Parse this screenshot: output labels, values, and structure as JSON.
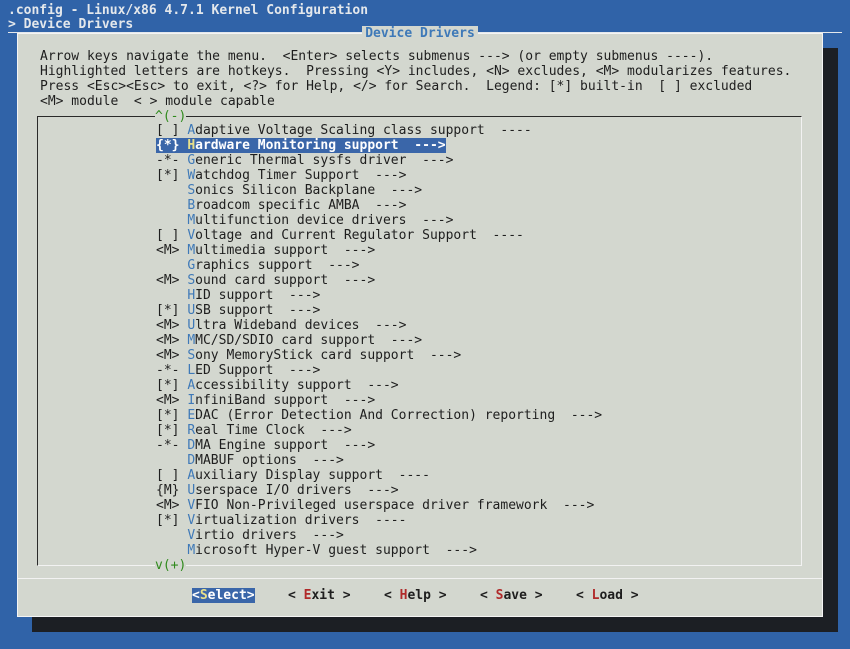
{
  "header": {
    "line1": ".config - Linux/x86 4.7.1 Kernel Configuration",
    "line2": "> Device Drivers"
  },
  "dialog": {
    "title": "Device Drivers",
    "help_lines": [
      "Arrow keys navigate the menu.  <Enter> selects submenus ---> (or empty submenus ----).",
      "Highlighted letters are hotkeys.  Pressing <Y> includes, <N> excludes, <M> modularizes features.",
      "Press <Esc><Esc> to exit, <?> for Help, </> for Search.  Legend: [*] built-in  [ ] excluded",
      "<M> module  < > module capable"
    ],
    "scroll_up": "^(-)",
    "scroll_down": "v(+)"
  },
  "menu": {
    "selected_index": 1,
    "items": [
      {
        "state": "[ ]",
        "hotkey": "A",
        "rest": "daptive Voltage Scaling class support  ----"
      },
      {
        "state": "{*}",
        "hotkey": "H",
        "rest": "ardware Monitoring support  --->"
      },
      {
        "state": "-*-",
        "hotkey": "G",
        "rest": "eneric Thermal sysfs driver  --->"
      },
      {
        "state": "[*]",
        "hotkey": "W",
        "rest": "atchdog Timer Support  --->"
      },
      {
        "state": "   ",
        "hotkey": "S",
        "rest": "onics Silicon Backplane  --->"
      },
      {
        "state": "   ",
        "hotkey": "B",
        "rest": "roadcom specific AMBA  --->"
      },
      {
        "state": "   ",
        "hotkey": "M",
        "rest": "ultifunction device drivers  --->"
      },
      {
        "state": "[ ]",
        "hotkey": "V",
        "rest": "oltage and Current Regulator Support  ----"
      },
      {
        "state": "<M>",
        "hotkey": "M",
        "rest": "ultimedia support  --->"
      },
      {
        "state": "   ",
        "hotkey": "G",
        "rest": "raphics support  --->"
      },
      {
        "state": "<M>",
        "hotkey": "S",
        "rest": "ound card support  --->"
      },
      {
        "state": "   ",
        "hotkey": "H",
        "rest": "ID support  --->"
      },
      {
        "state": "[*]",
        "hotkey": "U",
        "rest": "SB support  --->"
      },
      {
        "state": "<M>",
        "hotkey": "U",
        "rest": "ltra Wideband devices  --->"
      },
      {
        "state": "<M>",
        "hotkey": "M",
        "rest": "MC/SD/SDIO card support  --->"
      },
      {
        "state": "<M>",
        "hotkey": "S",
        "rest": "ony MemoryStick card support  --->"
      },
      {
        "state": "-*-",
        "hotkey": "L",
        "rest": "ED Support  --->"
      },
      {
        "state": "[*]",
        "hotkey": "A",
        "rest": "ccessibility support  --->"
      },
      {
        "state": "<M>",
        "hotkey": "I",
        "rest": "nfiniBand support  --->"
      },
      {
        "state": "[*]",
        "hotkey": "E",
        "rest": "DAC (Error Detection And Correction) reporting  --->"
      },
      {
        "state": "[*]",
        "hotkey": "R",
        "rest": "eal Time Clock  --->"
      },
      {
        "state": "-*-",
        "hotkey": "D",
        "rest": "MA Engine support  --->"
      },
      {
        "state": "   ",
        "hotkey": "D",
        "rest": "MABUF options  --->"
      },
      {
        "state": "[ ]",
        "hotkey": "A",
        "rest": "uxiliary Display support  ----"
      },
      {
        "state": "{M}",
        "hotkey": "U",
        "rest": "serspace I/O drivers  --->"
      },
      {
        "state": "<M>",
        "hotkey": "V",
        "rest": "FIO Non-Privileged userspace driver framework  --->"
      },
      {
        "state": "[*]",
        "hotkey": "V",
        "rest": "irtualization drivers  ----"
      },
      {
        "state": "   ",
        "hotkey": "V",
        "rest": "irtio drivers  --->"
      },
      {
        "state": "   ",
        "hotkey": "M",
        "rest": "icrosoft Hyper-V guest support  --->"
      }
    ]
  },
  "buttons": [
    {
      "pre": "<",
      "hotkey": "S",
      "post": "elect>"
    },
    {
      "pre": "< ",
      "hotkey": "E",
      "post": "xit >"
    },
    {
      "pre": "< ",
      "hotkey": "H",
      "post": "elp >"
    },
    {
      "pre": "< ",
      "hotkey": "S",
      "post": "ave >"
    },
    {
      "pre": "< ",
      "hotkey": "L",
      "post": "oad >"
    }
  ]
}
